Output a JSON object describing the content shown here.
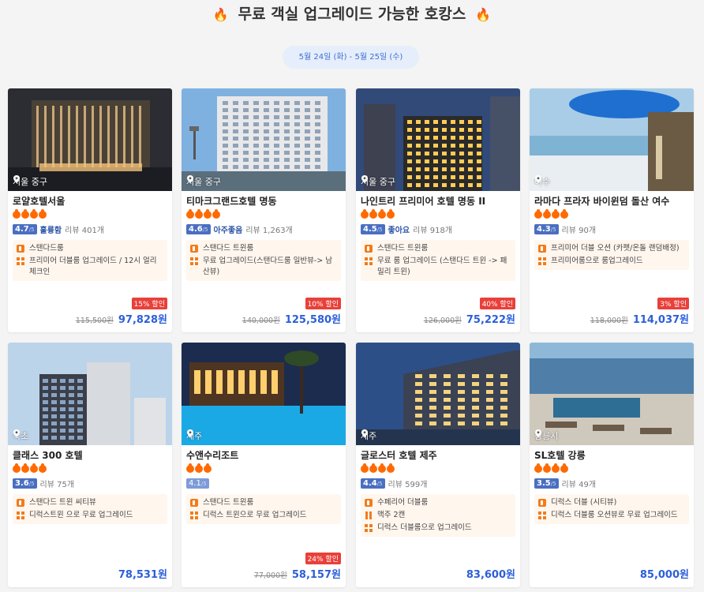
{
  "header": {
    "title": "무료 객실 업그레이드 가능한 호캉스",
    "flame_icon": "🔥",
    "date_range": "5월 24일 (화)  -  5월 25일 (수)"
  },
  "colors": {
    "accent": "#2b5fd9",
    "flame": "#ff6a00",
    "discount": "#e8403a",
    "perk_bg": "#fff6ee"
  },
  "hotels": [
    {
      "location": "서울 중구",
      "name": "로얄호텔서울",
      "stars": 4,
      "score": "4.7",
      "score_max": "/5",
      "grade": "훌륭함",
      "reviews": "리뷰 401개",
      "perks": [
        {
          "icon": "room-icon",
          "text": "스탠다드룸"
        },
        {
          "icon": "upgrade-icon",
          "text": "프리미어 더블룸 업그레이드 / 12시 얼리 체크인"
        }
      ],
      "discount": "15% 할인",
      "original_price": "115,500원",
      "price": "97,828원"
    },
    {
      "location": "서울 중구",
      "name": "티마크그랜드호텔 명동",
      "stars": 4,
      "score": "4.6",
      "score_max": "/5",
      "grade": "아주좋음",
      "reviews": "리뷰 1,263개",
      "perks": [
        {
          "icon": "room-icon",
          "text": "스탠다드 트윈룸"
        },
        {
          "icon": "upgrade-icon",
          "text": "무료 업그레이드(스탠다드룸 일반뷰-> 남산뷰)"
        }
      ],
      "discount": "10% 할인",
      "original_price": "140,000원",
      "price": "125,580원"
    },
    {
      "location": "서울 중구",
      "name": "나인트리 프리미어 호텔 명동 II",
      "stars": 4,
      "score": "4.5",
      "score_max": "/5",
      "grade": "좋아요",
      "reviews": "리뷰 918개",
      "perks": [
        {
          "icon": "room-icon",
          "text": "스탠다드 트윈룸"
        },
        {
          "icon": "upgrade-icon",
          "text": "무료 룸 업그레이드 (스탠다드 트윈 -> 패밀리 트윈)"
        }
      ],
      "discount": "40% 할인",
      "original_price": "126,000원",
      "price": "75,222원"
    },
    {
      "location": "여수",
      "name": "라마다 프라자 바이윈덤 돌산 여수",
      "stars": 4,
      "score": "4.3",
      "score_max": "/5",
      "grade": "",
      "reviews": "리뷰 90개",
      "perks": [
        {
          "icon": "room-icon",
          "text": "프리미어 더블 오션 (카펫/온돌 랜덤배정)"
        },
        {
          "icon": "upgrade-icon",
          "text": "프리미어룸으로 룸업그레이드"
        }
      ],
      "discount": "3% 할인",
      "original_price": "118,000원",
      "price": "114,037원"
    },
    {
      "location": "속초",
      "name": "클래스 300 호텔",
      "stars": 4,
      "score": "3.6",
      "score_max": "/5",
      "grade": "",
      "reviews": "리뷰 75개",
      "perks": [
        {
          "icon": "room-icon",
          "text": "스탠다드 트윈 씨티뷰"
        },
        {
          "icon": "upgrade-icon",
          "text": "디럭스트윈 으로 무료 업그레이드"
        }
      ],
      "discount": "",
      "original_price": "",
      "price": "78,531원"
    },
    {
      "location": "제주",
      "name": "수앤수리조트",
      "stars": 3,
      "score": "4.1",
      "score_max": "/5",
      "grade": "",
      "reviews": "",
      "perks": [
        {
          "icon": "room-icon",
          "text": "스탠다드 트윈룸"
        },
        {
          "icon": "upgrade-icon",
          "text": "디럭스 트윈으로 무료 업그레이드"
        }
      ],
      "discount": "24% 할인",
      "original_price": "77,000원",
      "price": "58,157원"
    },
    {
      "location": "제주",
      "name": "글로스터 호텔 제주",
      "stars": 4,
      "score": "4.4",
      "score_max": "/5",
      "grade": "",
      "reviews": "리뷰 599개",
      "perks": [
        {
          "icon": "room-icon",
          "text": "수페리어 더블룸"
        },
        {
          "icon": "meal-icon",
          "text": "맥주 2캔"
        },
        {
          "icon": "upgrade-icon",
          "text": "디럭스 더블룸으로 업그레이드"
        }
      ],
      "discount": "",
      "original_price": "",
      "price": "83,600원"
    },
    {
      "location": "강릉시",
      "name": "SL호텔 강릉",
      "stars": 4,
      "score": "3.5",
      "score_max": "/5",
      "grade": "",
      "reviews": "리뷰 49개",
      "perks": [
        {
          "icon": "room-icon",
          "text": "디럭스 더블 (시티뷰)"
        },
        {
          "icon": "upgrade-icon",
          "text": "디럭스 더블룸 오션뷰로 무료 업그레이드"
        }
      ],
      "discount": "",
      "original_price": "",
      "price": "85,000원"
    }
  ]
}
